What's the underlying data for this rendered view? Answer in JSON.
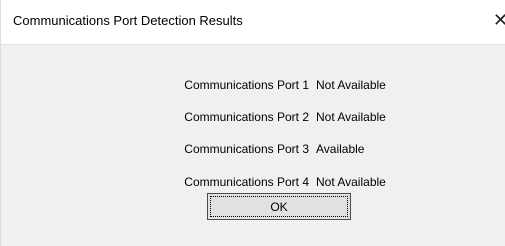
{
  "window": {
    "title": "Communications Port Detection Results",
    "close_glyph": "✕"
  },
  "ports": [
    {
      "label": "Communications Port 1",
      "status": "Not Available"
    },
    {
      "label": "Communications Port 2",
      "status": "Not Available"
    },
    {
      "label": "Communications Port 3",
      "status": "Available"
    },
    {
      "label": "Communications Port 4",
      "status": "Not Available"
    }
  ],
  "ok_label": "OK"
}
